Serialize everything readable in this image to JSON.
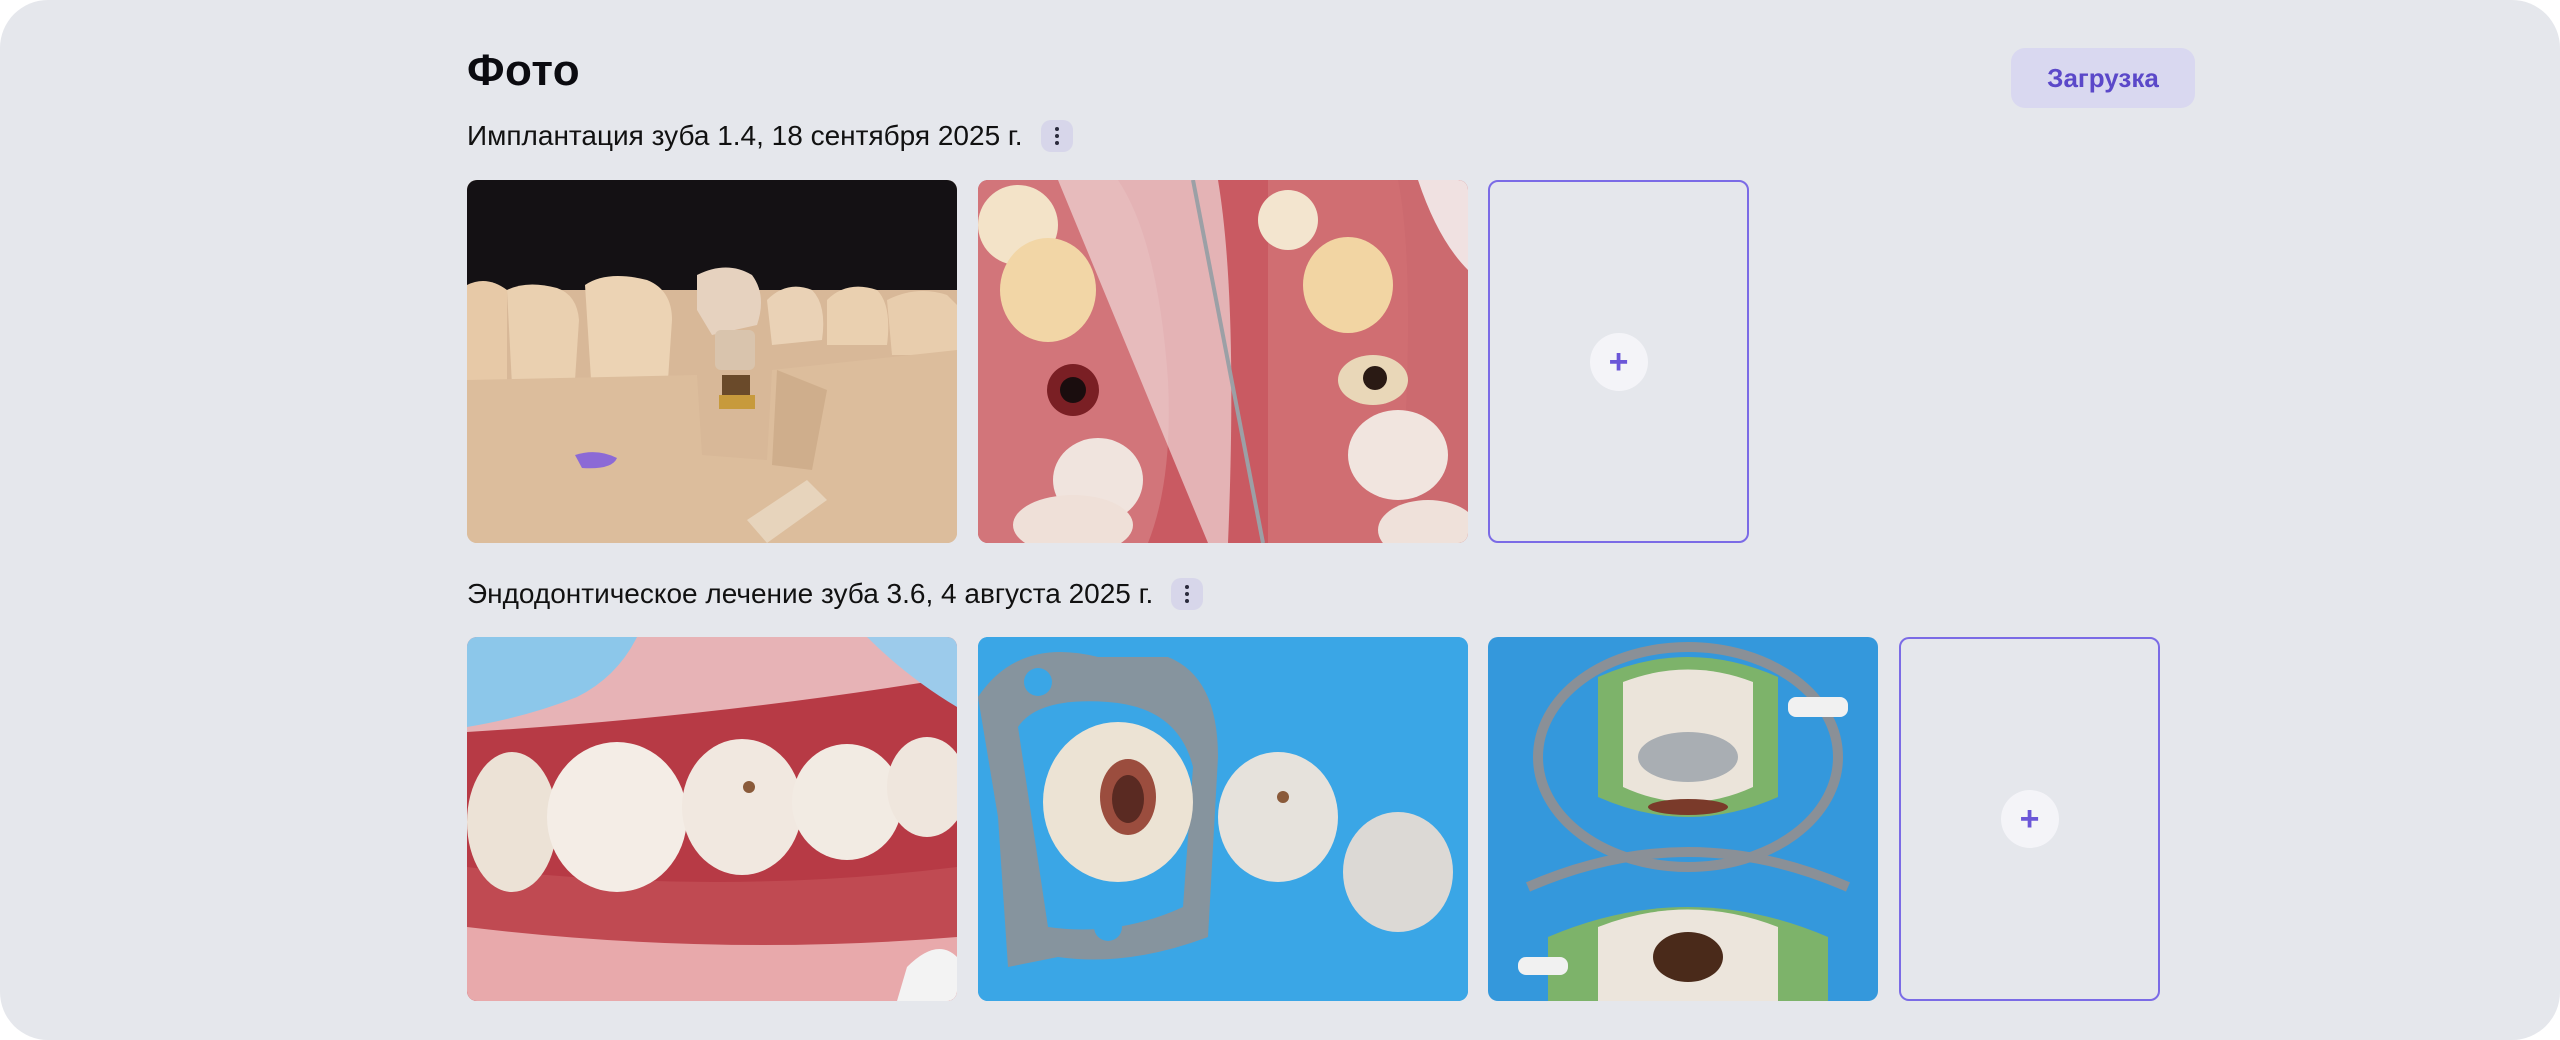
{
  "section": {
    "title": "Фото",
    "upload_label": "Загрузка"
  },
  "groups": [
    {
      "title": "Имплантация зуба 1.4, 18 сентября 2025 г.",
      "photos": [
        "dental-model-implant-photo",
        "implant-site-before-after-photo"
      ],
      "add_label": "+"
    },
    {
      "title": "Эндодонтическое лечение зуба 3.6, 4 августа 2025 г.",
      "photos": [
        "molars-intraoral-photo",
        "rubber-dam-access-cavity-photo",
        "matrix-clamp-restoration-photo"
      ],
      "add_label": "+"
    }
  ],
  "colors": {
    "panel_bg": "#e5e7ec",
    "accent": "#6b56d8",
    "button_bg": "#d9d8f0"
  }
}
